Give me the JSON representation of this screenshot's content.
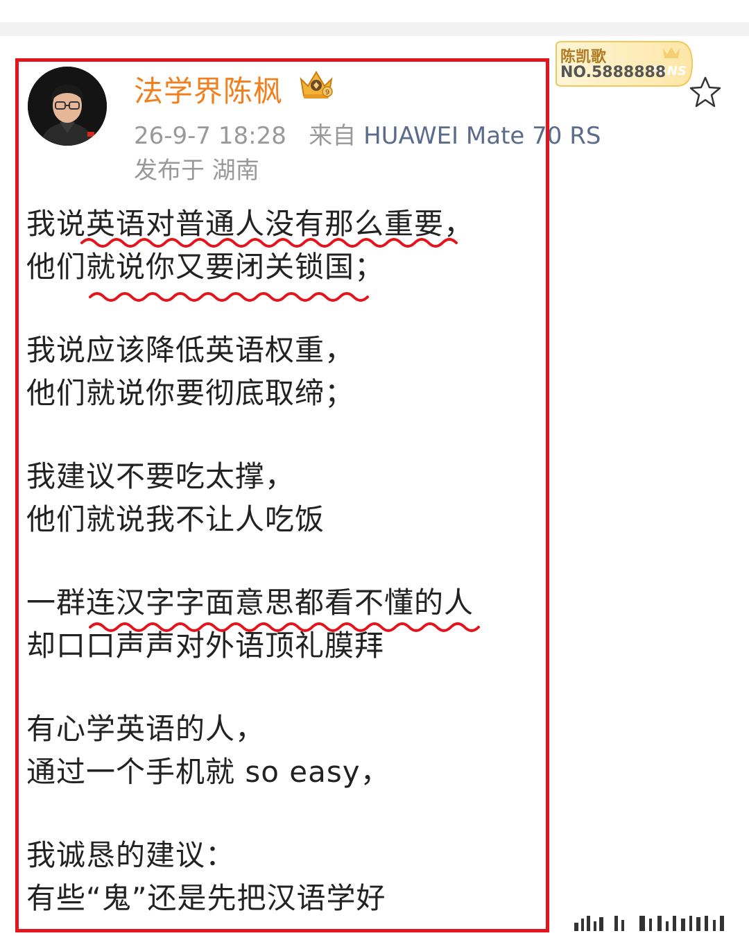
{
  "post": {
    "username": "法学界陈枫",
    "timestamp": "26-9-7 18:28",
    "source_prefix": "来自",
    "device": "HUAWEI Mate 70 RS",
    "location": "发布于 湖南",
    "fans_badge": {
      "name": "陈凯歌",
      "number": "NO.5888888",
      "label": "FANS"
    },
    "lines": [
      "我说英语对普通人没有那么重要，",
      "他们就说你又要闭关锁国；",
      "",
      "我说应该降低英语权重，",
      "他们就说你要彻底取缔；",
      "",
      "我建议不要吃太撑，",
      "他们就说我不让人吃饭",
      "",
      "一群连汉字字面意思都看不懂的人",
      "却口口声声对外语顶礼膜拜",
      "",
      "有心学英语的人，",
      "通过一个手机就 so easy，",
      "",
      "我诚恳的建议：",
      "有些“鬼”还是先把汉语学好"
    ]
  },
  "colors": {
    "username": "#f07f1e",
    "highlight_frame": "#e3141c",
    "underline": "#e3141c",
    "meta": "#999999",
    "device": "#5b6b8c"
  },
  "icons": [
    "crown-badge-icon",
    "fans-badge-icon",
    "star-favorite-icon",
    "avatar"
  ]
}
